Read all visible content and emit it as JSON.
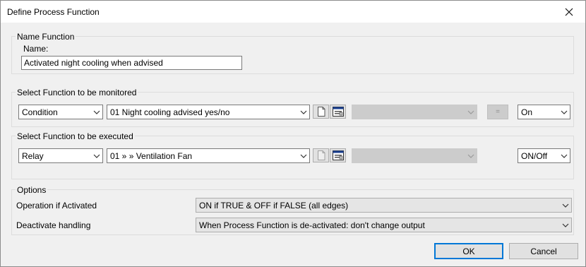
{
  "window": {
    "title": "Define Process Function"
  },
  "name_group": {
    "label": "Name Function",
    "name_label": "Name:",
    "name_value": "Activated night cooling when advised"
  },
  "monitored_group": {
    "label": "Select Function to be monitored",
    "type_value": "Condition",
    "function_value": "01  Night cooling advised yes/no",
    "extra_value": "",
    "compare_label": "=",
    "state_value": "On"
  },
  "executed_group": {
    "label": "Select Function to be executed",
    "type_value": "Relay",
    "function_value": "01  »  » Ventilation Fan",
    "extra_value": "",
    "state_value": "ON/Off"
  },
  "options_group": {
    "label": "Options",
    "operation_label": "Operation if Activated",
    "operation_value": "ON if TRUE & OFF if FALSE (all edges)",
    "deactivate_label": "Deactivate handling",
    "deactivate_value": "When Process Function is de-activated: don't change output"
  },
  "buttons": {
    "ok": "OK",
    "cancel": "Cancel"
  },
  "icons": {
    "close": "close-icon",
    "new_document": "new-document-icon",
    "properties": "properties-icon",
    "dropdown": "chevron-down-icon"
  }
}
